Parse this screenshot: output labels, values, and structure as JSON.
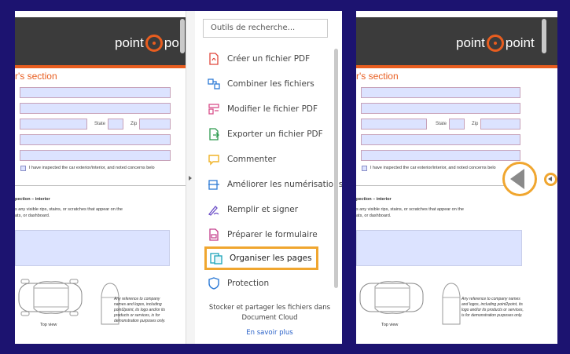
{
  "document": {
    "logo_left": "point",
    "logo_right_partial": "po",
    "logo_right_full": "point",
    "section_title": "r's section",
    "state_label": "State",
    "zip_label": "Zip",
    "checkbox_text": "I have inspected the car exterior/interior, and noted concerns belo",
    "interior_heading": "pection – interior",
    "interior_text_1": "s any visible rips, stains, or scratches that appear on the",
    "interior_text_2": "ats, or dashboard.",
    "top_view_label": "Top view",
    "disclaimer": "Any reference to company names and logos, including point2point, its logo and/or its products or services, is for demonstration purposes only."
  },
  "tools_panel": {
    "search_placeholder": "Outils de recherche...",
    "items": [
      {
        "label": "Créer un fichier PDF",
        "icon": "create-pdf-icon"
      },
      {
        "label": "Combiner les fichiers",
        "icon": "combine-files-icon"
      },
      {
        "label": "Modifier le fichier PDF",
        "icon": "edit-pdf-icon"
      },
      {
        "label": "Exporter un fichier PDF",
        "icon": "export-pdf-icon"
      },
      {
        "label": "Commenter",
        "icon": "comment-icon"
      },
      {
        "label": "Améliorer les numérisations",
        "icon": "enhance-scans-icon"
      },
      {
        "label": "Remplir et signer",
        "icon": "fill-sign-icon"
      },
      {
        "label": "Préparer le formulaire",
        "icon": "prepare-form-icon"
      },
      {
        "label": "Organiser les pages",
        "icon": "organize-pages-icon"
      },
      {
        "label": "Protection",
        "icon": "protect-icon"
      }
    ],
    "footer_line1": "Stocker et partager les fichiers dans",
    "footer_line2": "Document Cloud",
    "learn_more": "En savoir plus"
  },
  "colors": {
    "background": "#1c1370",
    "brand_orange": "#e85d1f",
    "highlight": "#f0a62f",
    "field_fill": "#dce3ff",
    "link": "#2a62c9"
  }
}
